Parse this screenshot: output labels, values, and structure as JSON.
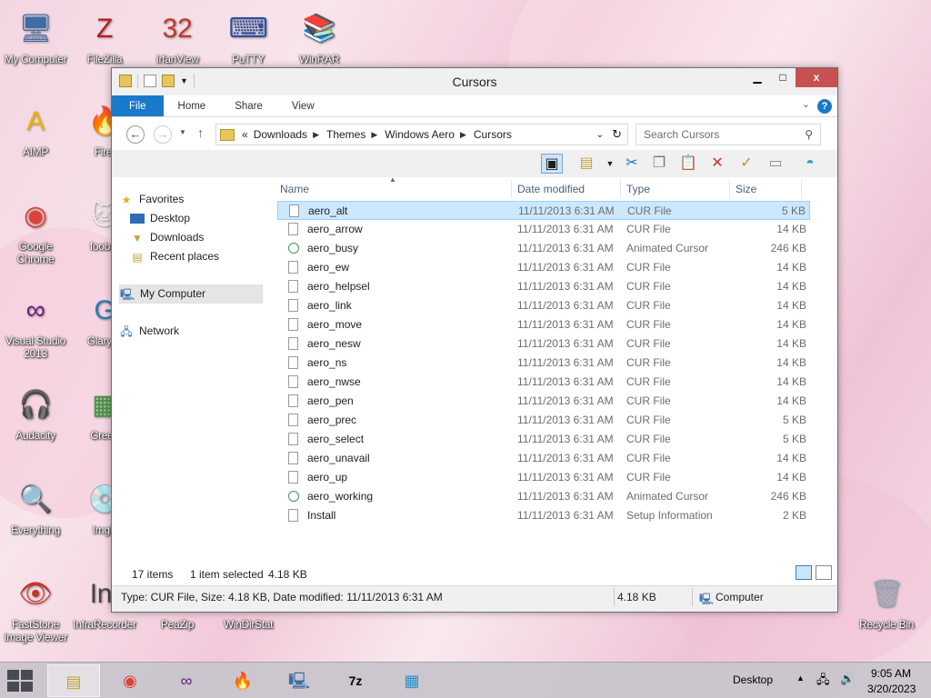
{
  "desktop": {
    "icons": [
      {
        "label": "My Computer",
        "glyph": "🖥"
      },
      {
        "label": "FileZilla",
        "glyph": "Z"
      },
      {
        "label": "IrfanView",
        "glyph": "32"
      },
      {
        "label": "PuTTY",
        "glyph": "⌨"
      },
      {
        "label": "WinRAR",
        "glyph": "📚"
      },
      {
        "label": "AIMP",
        "glyph": "A"
      },
      {
        "label": "Firef",
        "glyph": "🔥"
      },
      {
        "label": "Google Chrome",
        "glyph": "◉"
      },
      {
        "label": "foobar",
        "glyph": "🐱"
      },
      {
        "label": "Visual Studio 2013",
        "glyph": "∞"
      },
      {
        "label": "Glary U",
        "glyph": "G"
      },
      {
        "label": "Audacity",
        "glyph": "🎧"
      },
      {
        "label": "Green",
        "glyph": "▦"
      },
      {
        "label": "Everything",
        "glyph": "🔍"
      },
      {
        "label": "ImgB",
        "glyph": "💿"
      },
      {
        "label": "FastStone Image Viewer",
        "glyph": "👁"
      },
      {
        "label": "InfraRecorder",
        "glyph": "Inf"
      },
      {
        "label": "PeaZip",
        "glyph": "P"
      },
      {
        "label": "WinDirStat",
        "glyph": "▤"
      },
      {
        "label": "Recycle Bin",
        "glyph": "🗑"
      }
    ]
  },
  "window": {
    "title": "Cursors",
    "controls": {
      "minimize": "▁",
      "maximize": "□",
      "close": "x"
    },
    "ribbon_tabs": {
      "file": "File",
      "home": "Home",
      "share": "Share",
      "view": "View"
    },
    "help": "?",
    "address": {
      "overflow": "«",
      "crumbs": [
        "Downloads",
        "Themes",
        "Windows Aero",
        "Cursors"
      ]
    },
    "search_placeholder": "Search Cursors",
    "nav": {
      "favorites": "Favorites",
      "desktop": "Desktop",
      "downloads": "Downloads",
      "recent": "Recent places",
      "my_computer": "My Computer",
      "network": "Network"
    },
    "columns": {
      "name": "Name",
      "date": "Date modified",
      "type": "Type",
      "size": "Size"
    },
    "files": [
      {
        "name": "aero_alt",
        "date": "11/11/2013 6:31 AM",
        "type": "CUR File",
        "size": "5 KB",
        "anim": false
      },
      {
        "name": "aero_arrow",
        "date": "11/11/2013 6:31 AM",
        "type": "CUR File",
        "size": "14 KB",
        "anim": false
      },
      {
        "name": "aero_busy",
        "date": "11/11/2013 6:31 AM",
        "type": "Animated Cursor",
        "size": "246 KB",
        "anim": true
      },
      {
        "name": "aero_ew",
        "date": "11/11/2013 6:31 AM",
        "type": "CUR File",
        "size": "14 KB",
        "anim": false
      },
      {
        "name": "aero_helpsel",
        "date": "11/11/2013 6:31 AM",
        "type": "CUR File",
        "size": "14 KB",
        "anim": false
      },
      {
        "name": "aero_link",
        "date": "11/11/2013 6:31 AM",
        "type": "CUR File",
        "size": "14 KB",
        "anim": false
      },
      {
        "name": "aero_move",
        "date": "11/11/2013 6:31 AM",
        "type": "CUR File",
        "size": "14 KB",
        "anim": false
      },
      {
        "name": "aero_nesw",
        "date": "11/11/2013 6:31 AM",
        "type": "CUR File",
        "size": "14 KB",
        "anim": false
      },
      {
        "name": "aero_ns",
        "date": "11/11/2013 6:31 AM",
        "type": "CUR File",
        "size": "14 KB",
        "anim": false
      },
      {
        "name": "aero_nwse",
        "date": "11/11/2013 6:31 AM",
        "type": "CUR File",
        "size": "14 KB",
        "anim": false
      },
      {
        "name": "aero_pen",
        "date": "11/11/2013 6:31 AM",
        "type": "CUR File",
        "size": "14 KB",
        "anim": false
      },
      {
        "name": "aero_prec",
        "date": "11/11/2013 6:31 AM",
        "type": "CUR File",
        "size": "5 KB",
        "anim": false
      },
      {
        "name": "aero_select",
        "date": "11/11/2013 6:31 AM",
        "type": "CUR File",
        "size": "5 KB",
        "anim": false
      },
      {
        "name": "aero_unavail",
        "date": "11/11/2013 6:31 AM",
        "type": "CUR File",
        "size": "14 KB",
        "anim": false
      },
      {
        "name": "aero_up",
        "date": "11/11/2013 6:31 AM",
        "type": "CUR File",
        "size": "14 KB",
        "anim": false
      },
      {
        "name": "aero_working",
        "date": "11/11/2013 6:31 AM",
        "type": "Animated Cursor",
        "size": "246 KB",
        "anim": true
      },
      {
        "name": "Install",
        "date": "11/11/2013 6:31 AM",
        "type": "Setup Information",
        "size": "2 KB",
        "anim": false
      }
    ],
    "selected_index": 0,
    "status": {
      "count": "17 items",
      "selection": "1 item selected",
      "selection_size": "4.18 KB"
    },
    "details": {
      "info": "Type: CUR File, Size: 4.18 KB, Date modified: 11/11/2013 6:31 AM",
      "size": "4.18 KB",
      "location": "Computer"
    }
  },
  "taskbar": {
    "desktop_label": "Desktop",
    "time": "9:05 AM",
    "date": "3/20/2023"
  },
  "colors": {
    "accent": "#1979ca",
    "selection": "#cce8ff",
    "close": "#c75050"
  }
}
